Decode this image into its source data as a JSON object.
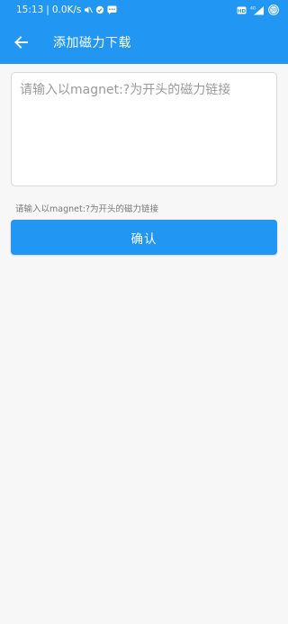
{
  "status_bar": {
    "time": "15:13",
    "separator": "|",
    "speed": "0.0K/s",
    "network": "4G",
    "battery": "59"
  },
  "app_bar": {
    "title": "添加磁力下载",
    "back_icon": "arrow-left-icon"
  },
  "form": {
    "magnet_input": {
      "value": "",
      "placeholder": "请输入以magnet:?为开头的磁力链接"
    },
    "helper_text": "请输入以magnet:?为开头的磁力链接",
    "confirm_label": "确认"
  },
  "colors": {
    "primary": "#2196f3",
    "background": "#f7f7f7"
  }
}
